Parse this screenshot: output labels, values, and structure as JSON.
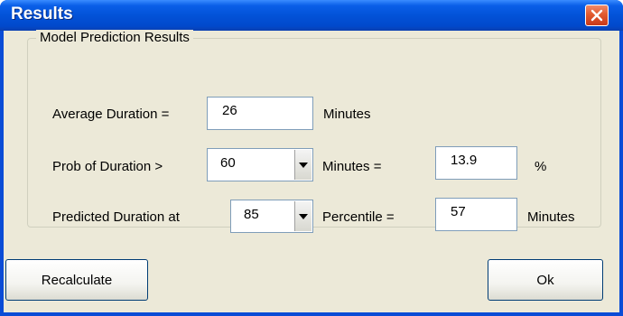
{
  "window": {
    "title": "Results"
  },
  "group": {
    "label": "Model Prediction Results"
  },
  "rows": {
    "average": {
      "label": "Average Duration =",
      "value": "26",
      "unit": "Minutes"
    },
    "prob": {
      "label": "Prob of Duration >",
      "selected": "60",
      "mid_label": "Minutes =",
      "result": "13.9",
      "unit": "%"
    },
    "predicted": {
      "label": "Predicted Duration at",
      "selected": "85",
      "mid_label": "Percentile =",
      "result": "57",
      "unit": "Minutes"
    }
  },
  "buttons": {
    "recalculate": "Recalculate",
    "ok": "Ok"
  },
  "icons": {
    "close": "close-icon",
    "dropdown": "chevron-down-icon"
  },
  "colors": {
    "titlebar": "#0252d8",
    "close": "#e25a2e",
    "face": "#ece9d8"
  }
}
